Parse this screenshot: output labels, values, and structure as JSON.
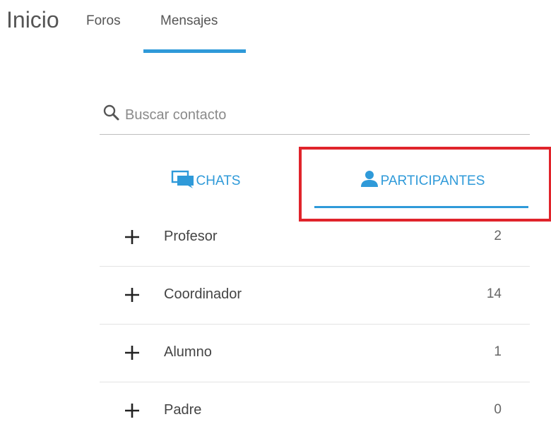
{
  "nav": {
    "home": "Inicio",
    "tabs": [
      {
        "label": "Foros"
      },
      {
        "label": "Mensajes",
        "active": true
      }
    ]
  },
  "search": {
    "placeholder": "Buscar contacto",
    "value": ""
  },
  "subtabs": [
    {
      "label": "CHATS",
      "icon": "chat-icon"
    },
    {
      "label": "PARTICIPANTES",
      "icon": "person-icon",
      "active": true
    }
  ],
  "groups": [
    {
      "label": "Profesor",
      "count": "2"
    },
    {
      "label": "Coordinador",
      "count": "14"
    },
    {
      "label": "Alumno",
      "count": "1"
    },
    {
      "label": "Padre",
      "count": "0"
    }
  ],
  "colors": {
    "accent": "#2f9ad9",
    "highlight": "#e0242b"
  }
}
